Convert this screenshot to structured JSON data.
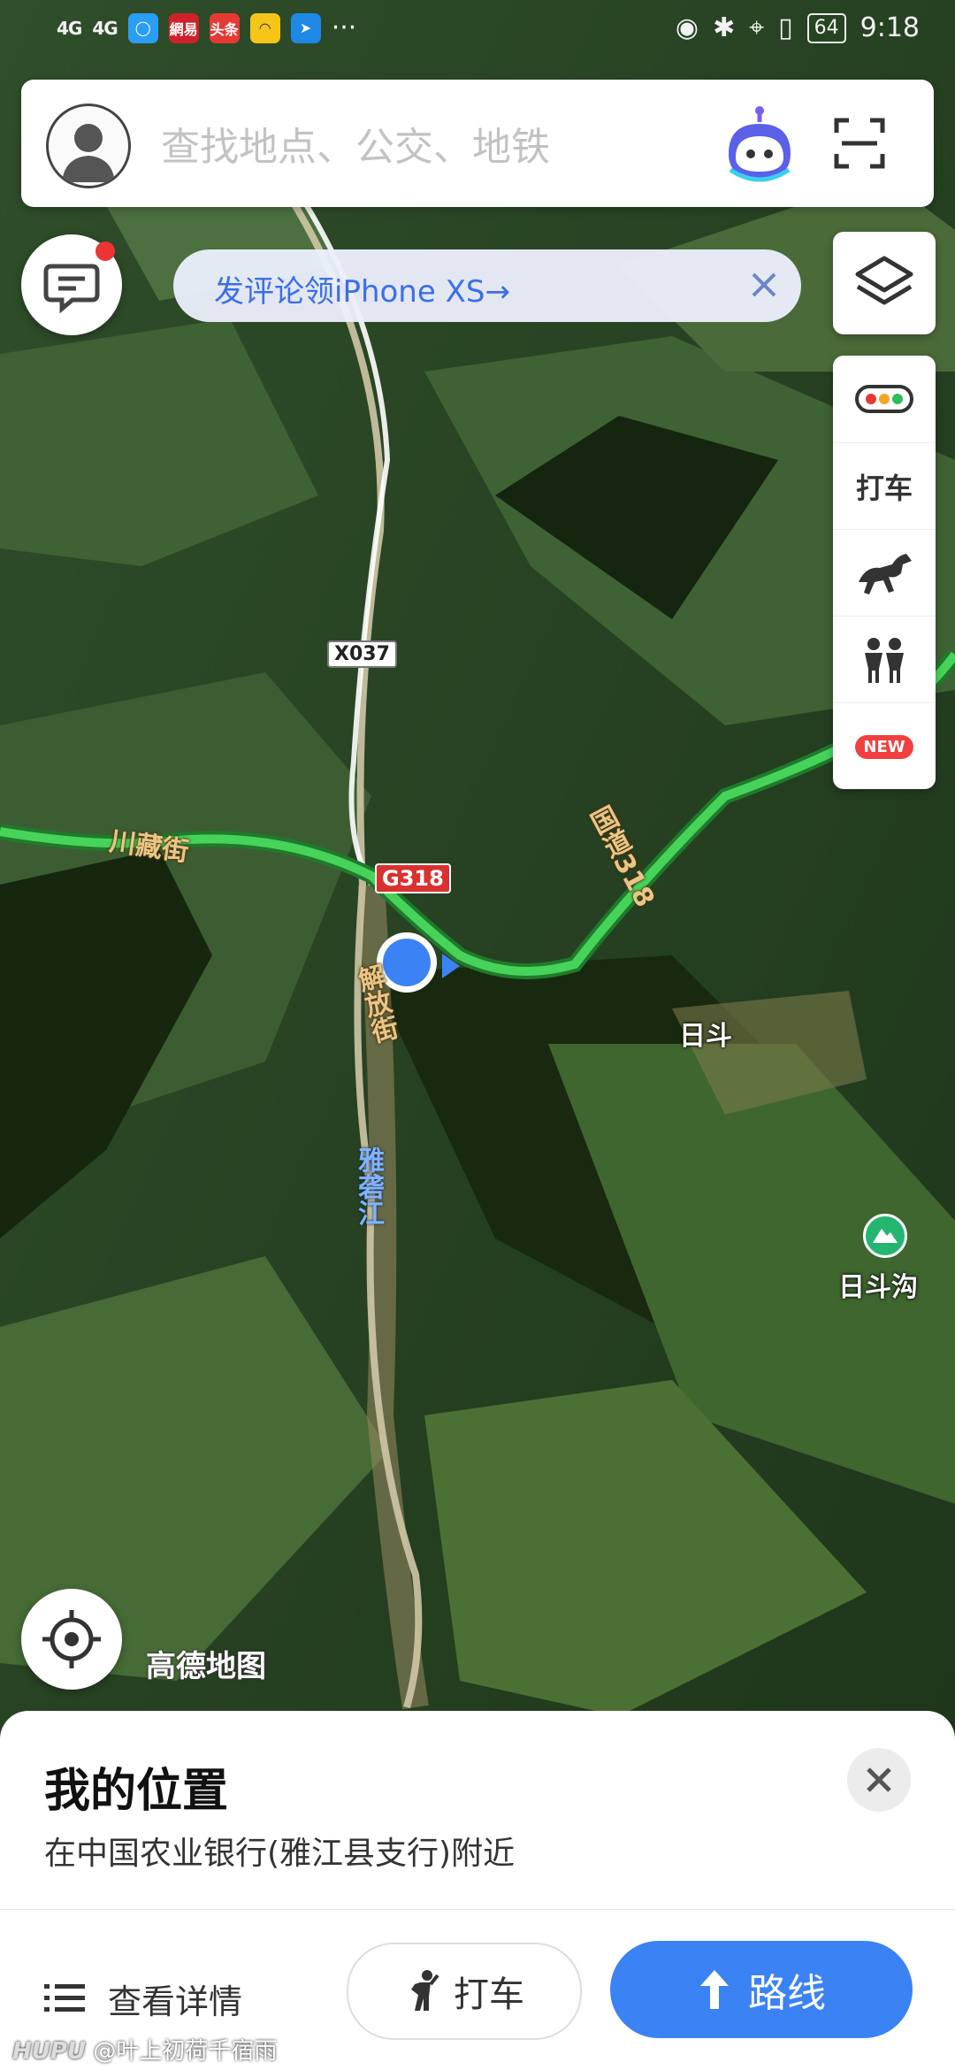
{
  "status_bar": {
    "signal_1": "4G",
    "signal_2": "4G",
    "app_icons": [
      "browser-icon",
      "netease-news-icon",
      "toutiao-icon",
      "bilibili-icon",
      "send-icon"
    ],
    "app_text": {
      "netease": "網易",
      "toutiao": "头条"
    },
    "more": "···",
    "battery": "64",
    "time": "9:18"
  },
  "search": {
    "placeholder": "查找地点、公交、地铁"
  },
  "banner": {
    "text": "发评论领iPhone XS→"
  },
  "tools": {
    "taxi_label": "打车",
    "new_badge": "NEW"
  },
  "map_labels": {
    "x037": "X037",
    "g318": "G318",
    "chuanzang": "川藏街",
    "guodao": "国道318",
    "jiefang": "解放街",
    "yalong": "雅砻江",
    "ridou": "日斗",
    "ridougou": "日斗沟",
    "logo": "高德地图"
  },
  "location": {
    "title": "我的位置",
    "subtitle": "在中国农业银行(雅江县支行)附近"
  },
  "actions": {
    "details_label": "查看详情",
    "taxi_label": "打车",
    "route_label": "路线"
  },
  "colors": {
    "accent": "#3b82f4",
    "road_green": "#47d35a",
    "banner_text": "#3d6ee6"
  },
  "watermark": {
    "brand": "HUPU",
    "user": "@叶上初荷千宿雨"
  }
}
